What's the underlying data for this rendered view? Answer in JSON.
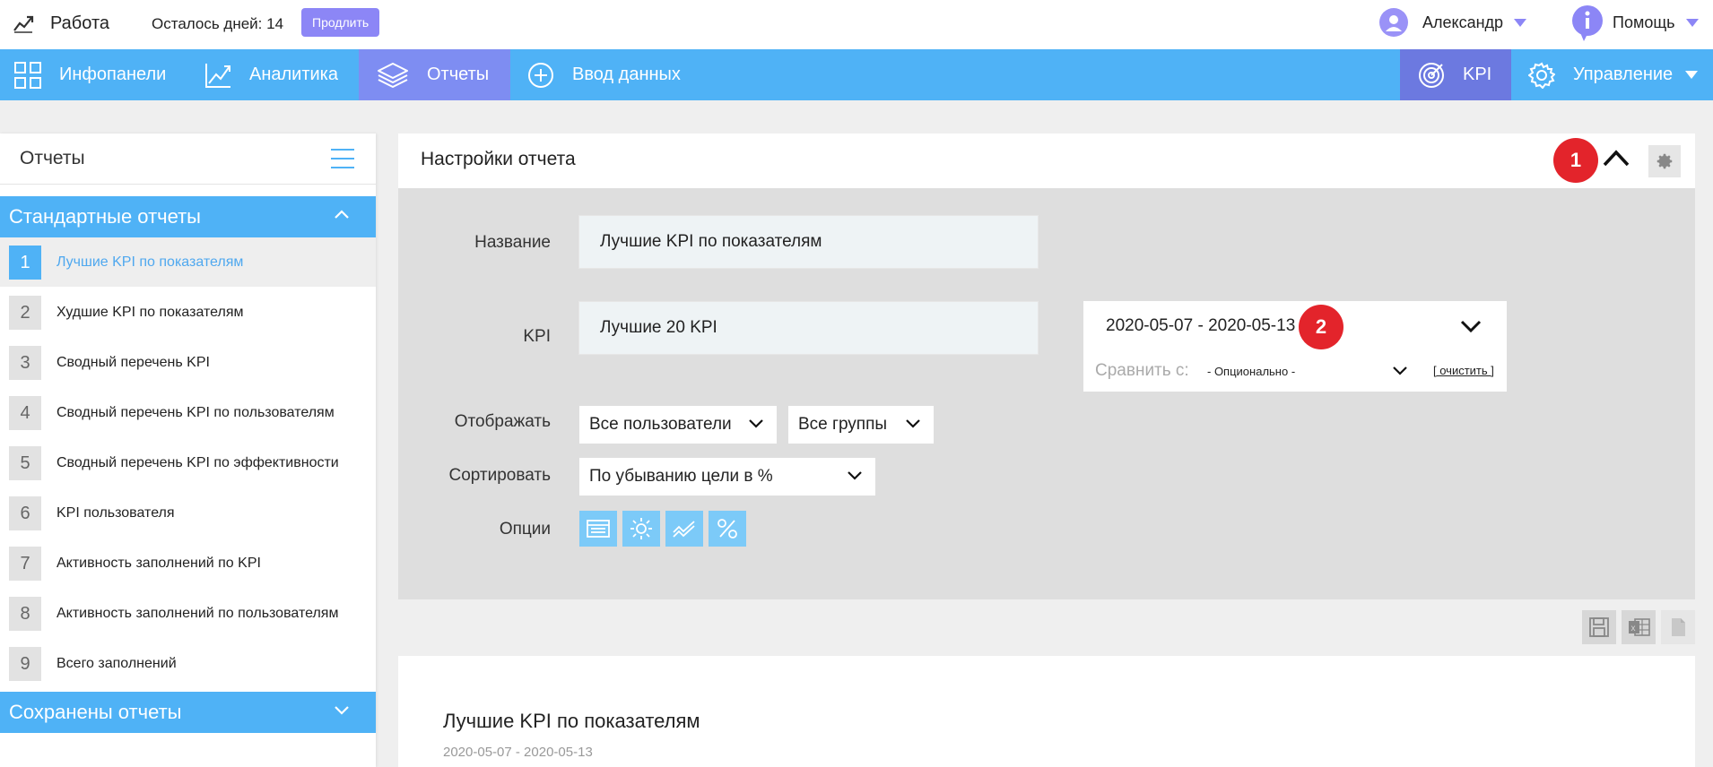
{
  "topbar": {
    "app_title": "Работа",
    "days_left": "Осталось дней: 14",
    "extend_button": "Продлить",
    "user_name": "Александр",
    "help_label": "Помощь"
  },
  "nav": {
    "items": [
      {
        "label": "Инфопанели",
        "icon": "grid-icon"
      },
      {
        "label": "Аналитика",
        "icon": "chart-icon"
      },
      {
        "label": "Отчеты",
        "icon": "layers-icon",
        "active": true
      },
      {
        "label": "Ввод данных",
        "icon": "plus-circle-icon"
      },
      {
        "label": "KPI",
        "icon": "target-icon"
      },
      {
        "label": "Управление",
        "icon": "gear-icon"
      }
    ]
  },
  "sidebar": {
    "title": "Отчеты",
    "standard_section": "Стандартные отчеты",
    "saved_section": "Сохранены отчеты",
    "reports": [
      {
        "num": "1",
        "label": "Лучшие KPI по показателям",
        "active": true
      },
      {
        "num": "2",
        "label": "Худшие KPI по показателям"
      },
      {
        "num": "3",
        "label": "Сводный перечень KPI"
      },
      {
        "num": "4",
        "label": "Сводный перечень KPI по пользователям"
      },
      {
        "num": "5",
        "label": "Сводный перечень KPI по эффективности"
      },
      {
        "num": "6",
        "label": "KPI пользователя"
      },
      {
        "num": "7",
        "label": "Активность заполнений по KPI"
      },
      {
        "num": "8",
        "label": "Активность заполнений по пользователям"
      },
      {
        "num": "9",
        "label": "Всего заполнений"
      }
    ]
  },
  "settings": {
    "title": "Настройки отчета",
    "badge_1": "1",
    "badge_2": "2",
    "name_label": "Название",
    "name_value": "Лучшие KPI по показателям",
    "kpi_label": "KPI",
    "kpi_value": "Лучшие 20 KPI",
    "date_range": "2020-05-07 - 2020-05-13",
    "compare_label": "Сравнить с:",
    "compare_value": "- Опционально -",
    "clear_link": "[ очистить ]",
    "display_label": "Отображать",
    "display_users": "Все пользователи",
    "display_groups": "Все группы",
    "sort_label": "Сортировать",
    "sort_value": "По убыванию цели в %",
    "options_label": "Опции"
  },
  "report": {
    "title": "Лучшие KPI по показателям",
    "period": "2020-05-07 - 2020-05-13"
  },
  "colors": {
    "nav_blue": "#4fb2f6",
    "active_purple": "#7e8df2",
    "badge_red": "#e3242b"
  }
}
